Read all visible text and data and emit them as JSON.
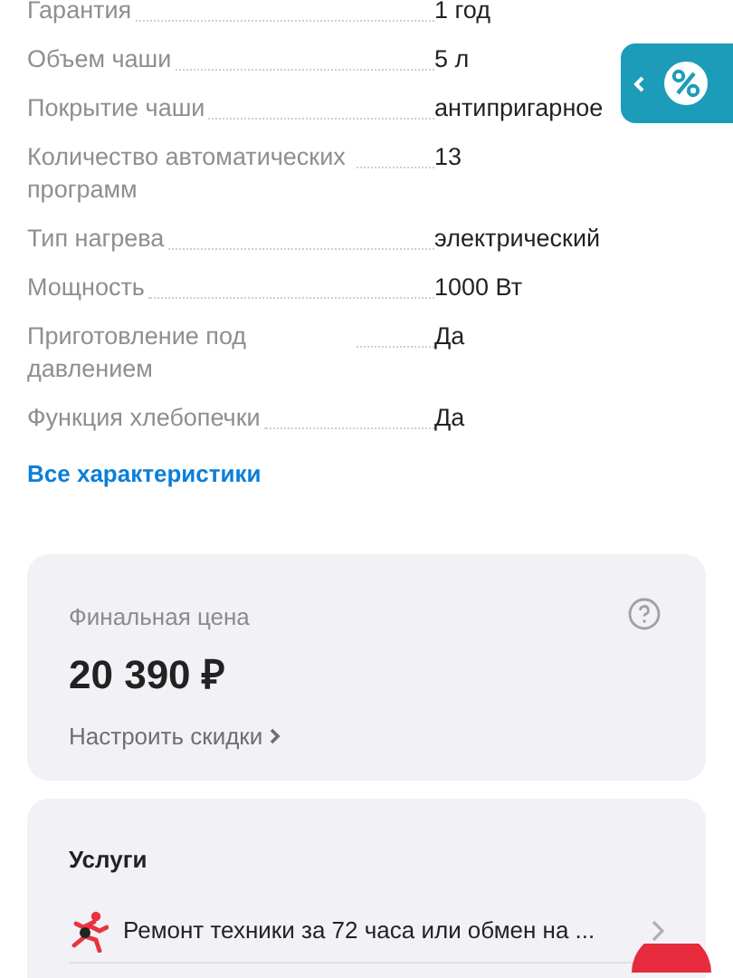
{
  "specs": [
    {
      "label": "Гарантия",
      "value": "1 год"
    },
    {
      "label": "Объем чаши",
      "value": "5 л"
    },
    {
      "label": "Покрытие чаши",
      "value": "антипригарное"
    },
    {
      "label": "Количество автоматических программ",
      "value": "13"
    },
    {
      "label": "Тип нагрева",
      "value": "электрический"
    },
    {
      "label": "Мощность",
      "value": "1000 Вт"
    },
    {
      "label": "Приготовление под давлением",
      "value": "Да"
    },
    {
      "label": "Функция хлебопечки",
      "value": "Да"
    }
  ],
  "all_specs_link": "Все характеристики",
  "price_card": {
    "label": "Финальная цена",
    "price": "20 390 ₽",
    "discount_link": "Настроить скидки"
  },
  "services": {
    "title": "Услуги",
    "items": [
      {
        "text": "Ремонт техники за 72 часа или обмен на ..."
      }
    ]
  }
}
